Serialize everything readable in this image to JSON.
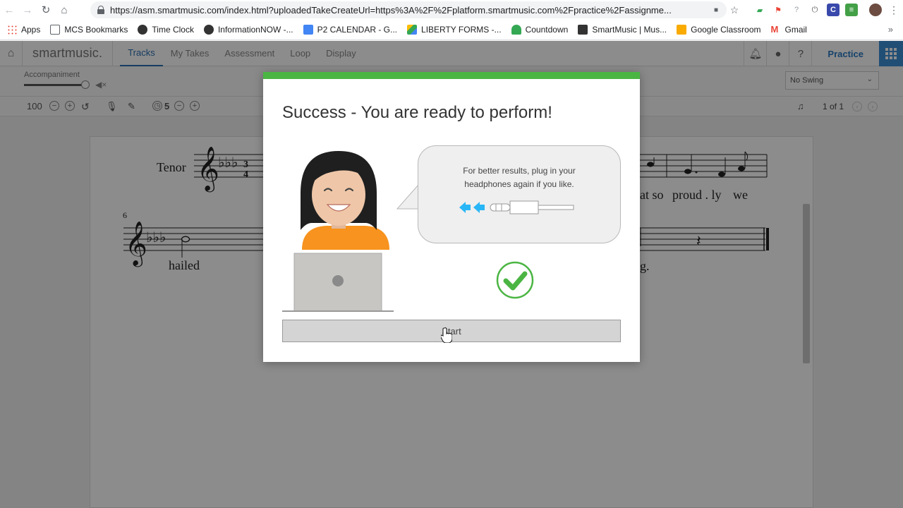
{
  "browser": {
    "url": "https://asm.smartmusic.com/index.html?uploadedTakeCreateUrl=https%3A%2F%2Fplatform.smartmusic.com%2Fpractice%2Fassignme...",
    "bookmarks": [
      "Apps",
      "MCS Bookmarks",
      "Time Clock",
      "InformationNOW -...",
      "P2 CALENDAR - G...",
      "LIBERTY FORMS -...",
      "Countdown",
      "SmartMusic | Mus...",
      "Google Classroom",
      "Gmail"
    ],
    "bookmark_colors": [
      "#4285f4",
      "#5f6368",
      "#333333",
      "#333333",
      "#4285f4",
      "#fbbc04",
      "#34a853",
      "#333333",
      "#f9ab00",
      "#ea4335"
    ],
    "more": "»"
  },
  "app": {
    "logo": "smartmusic.",
    "tabs": [
      "Tracks",
      "My Takes",
      "Assessment",
      "Loop",
      "Display"
    ],
    "active_tab": "Tracks",
    "practice_label": "Practice",
    "accompaniment_label": "Accompaniment",
    "swing_value": "No Swing",
    "tempo": "100",
    "count_in": "5",
    "page_indicator": "1 of 1",
    "accent_color": "#2a6fb0"
  },
  "score": {
    "part_name": "Tenor",
    "measure_number": "6",
    "lyrics": [
      "hailed",
      "at so",
      "proud . ly",
      "we",
      "g."
    ]
  },
  "modal": {
    "title": "Success - You are ready to perform!",
    "tip_line1": "For better results, plug in your",
    "tip_line2": "headphones again if you like.",
    "start_label": "Start",
    "success_color": "#4bb543"
  }
}
